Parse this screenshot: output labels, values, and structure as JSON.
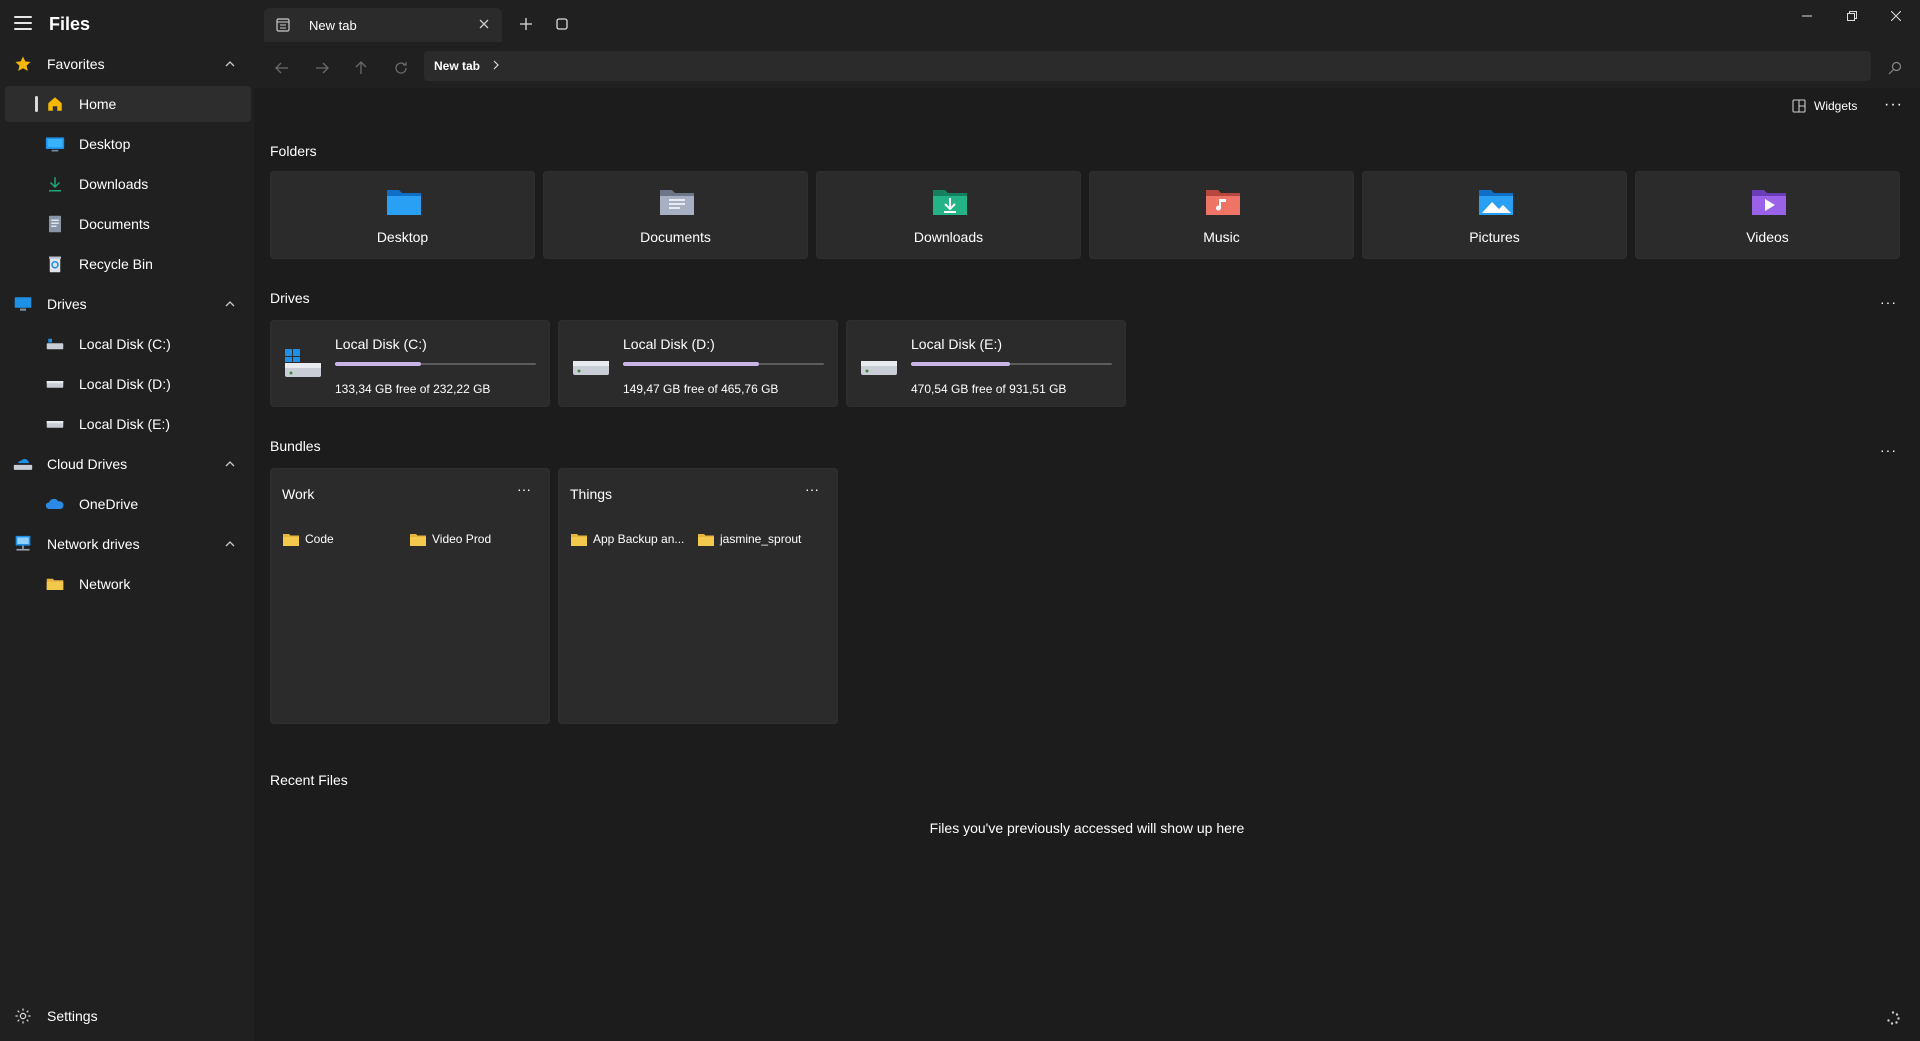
{
  "app": {
    "title": "Files"
  },
  "sidebar": {
    "favorites": {
      "label": "Favorites",
      "items": [
        {
          "label": "Home",
          "icon": "home-icon",
          "active": true
        },
        {
          "label": "Desktop",
          "icon": "desktop-icon"
        },
        {
          "label": "Downloads",
          "icon": "downloads-icon"
        },
        {
          "label": "Documents",
          "icon": "documents-icon"
        },
        {
          "label": "Recycle Bin",
          "icon": "recycle-bin-icon"
        }
      ]
    },
    "drives": {
      "label": "Drives",
      "items": [
        {
          "label": "Local Disk (C:)"
        },
        {
          "label": "Local Disk (D:)"
        },
        {
          "label": "Local Disk (E:)"
        }
      ]
    },
    "cloud": {
      "label": "Cloud Drives",
      "items": [
        {
          "label": "OneDrive"
        }
      ]
    },
    "network": {
      "label": "Network drives",
      "items": [
        {
          "label": "Network"
        }
      ]
    },
    "settings_label": "Settings"
  },
  "tabs": [
    {
      "label": "New tab"
    }
  ],
  "address": {
    "crumb": "New tab"
  },
  "toolbar": {
    "widgets_label": "Widgets"
  },
  "sections": {
    "folders": "Folders",
    "drives": "Drives",
    "bundles": "Bundles",
    "recent": "Recent Files"
  },
  "folders": [
    {
      "label": "Desktop",
      "color": "#1e90e6"
    },
    {
      "label": "Documents",
      "color": "#8a95a8"
    },
    {
      "label": "Downloads",
      "color": "#1fa57a"
    },
    {
      "label": "Music",
      "color": "#e0605a"
    },
    {
      "label": "Pictures",
      "color": "#2196f3"
    },
    {
      "label": "Videos",
      "color": "#8b56d9"
    }
  ],
  "drives": [
    {
      "name": "Local Disk (C:)",
      "free": "133,34 GB free of 232,22 GB",
      "used_fraction": 0.426
    },
    {
      "name": "Local Disk (D:)",
      "free": "149,47 GB free of 465,76 GB",
      "used_fraction": 0.679
    },
    {
      "name": "Local Disk (E:)",
      "free": "470,54 GB free of 931,51 GB",
      "used_fraction": 0.495
    }
  ],
  "bundles": [
    {
      "name": "Work",
      "items": [
        "Code",
        "Video Prod"
      ]
    },
    {
      "name": "Things",
      "items": [
        "App Backup an...",
        "jasmine_sprout"
      ]
    }
  ],
  "recent": {
    "empty_message": "Files you've previously accessed will show up here"
  },
  "colors": {
    "accent": "#c9b6e8",
    "folder_yellow": "#f2c94c"
  }
}
